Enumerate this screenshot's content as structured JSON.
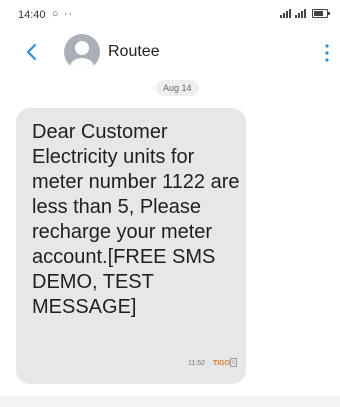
{
  "status_bar": {
    "time": "14:40",
    "left_icons": "○ ··"
  },
  "header": {
    "contact_name": "Routee",
    "accent_color": "#2b8be8"
  },
  "conversation": {
    "date": "Aug 14"
  },
  "message": {
    "body": "Dear Customer Electricity units for meter number 1122 are less than 5, Please recharge your meter account.[FREE SMS DEMO, TEST MESSAGE]",
    "time": "11:52",
    "sim": "TIGO",
    "bubble_color": "#e7e7e7"
  }
}
